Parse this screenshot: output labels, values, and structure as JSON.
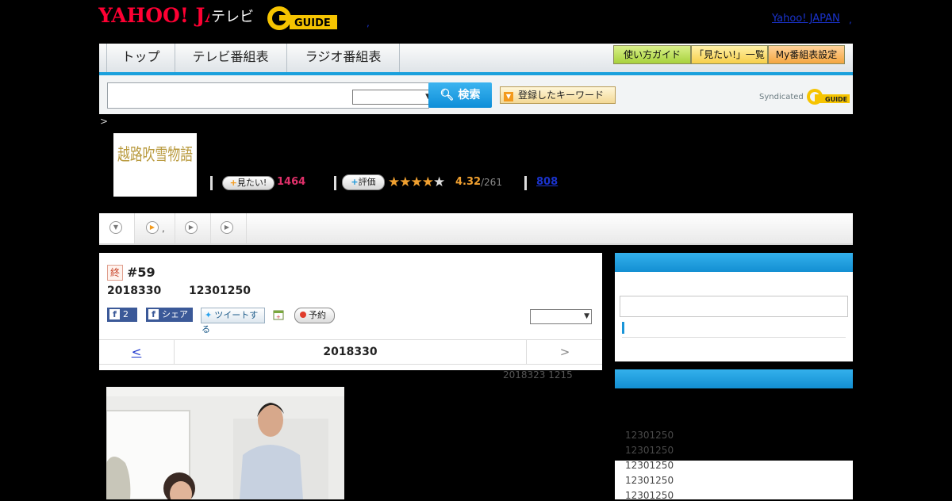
{
  "header": {
    "yahoo_logo": "YAHOO! JAPAN",
    "tv_label": "テレビ",
    "gguide_logo": "G-GUIDE",
    "yahoo_japan_link": "Yahoo! JAPAN",
    "link_sep": ","
  },
  "nav": {
    "tabs": [
      "トップ",
      "テレビ番組表",
      "ラジオ番組表"
    ],
    "guide_buttons": [
      "使い方ガイド",
      "「見たい!」一覧",
      "My番組表設定"
    ]
  },
  "search": {
    "placeholder": "",
    "button_label": "検索",
    "keyword_button": "登録したキーワード",
    "syndicated": "Syndicated"
  },
  "breadcrumb": ">",
  "program": {
    "thumbnail_title": "越路吹雪物語",
    "mitai_label": "見たい!",
    "mitai_count": "1464",
    "hyoka_label": "評価",
    "rating": "4.32",
    "rating_total": "/261",
    "stars": 4.32,
    "review_count": "808"
  },
  "subtabs": {
    "dot": ","
  },
  "episode": {
    "end_badge": "終",
    "number": "#59",
    "date": "2018330",
    "time": "12301250",
    "fb_count": "2",
    "fb_share": "シェア",
    "tweet": "ツイートする",
    "reserve": "予約",
    "prev": "<",
    "current_date": "2018330",
    "next": ">",
    "update": "2018323  1215"
  },
  "schedule": {
    "items": [
      "12301250",
      "12301250",
      "12301250",
      "12301250",
      "12301250"
    ]
  },
  "colors": {
    "accent_blue": "#1aa0dc",
    "mitai_pink": "#e0306a",
    "rating_orange": "#f0a030"
  }
}
